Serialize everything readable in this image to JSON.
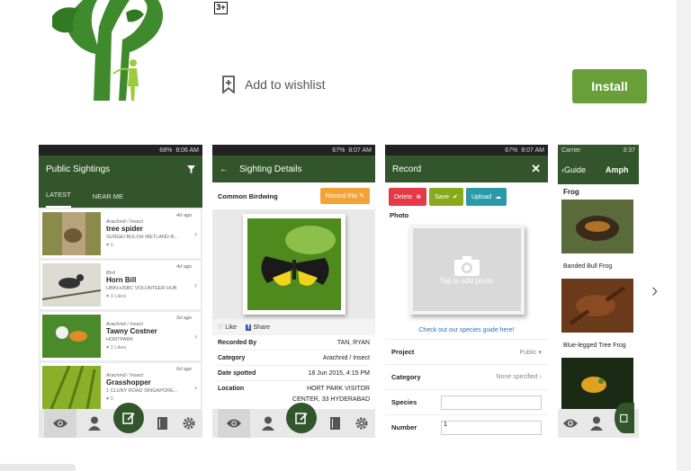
{
  "header": {
    "content_rating": "3+",
    "wishlist_label": "Add to wishlist",
    "install_label": "Install"
  },
  "screens": {
    "s1": {
      "status_time": "8:06 AM",
      "status_battery": "68%",
      "title": "Public Sightings",
      "tabs": [
        "LATEST",
        "NEAR ME"
      ],
      "items": [
        {
          "category": "Arachnid / Insect",
          "ago": "4d ago",
          "name": "tree spider",
          "location": "SUNGEI BULOH WETLAND R...",
          "likes": "0"
        },
        {
          "category": "Bird",
          "ago": "4d ago",
          "name": "Horn Bill",
          "location": "UBIN-HSBC VOLUNTEER HUB",
          "likes": "3 Likes"
        },
        {
          "category": "Arachnid / Insect",
          "ago": "5d ago",
          "name": "Tawny Costner",
          "location": "HORTPARK",
          "likes": "2 Likes"
        },
        {
          "category": "Arachnid / Insect",
          "ago": "6d ago",
          "name": "Grasshopper",
          "location": "1 CLUNY ROAD SINGAPORE...",
          "likes": "0"
        }
      ]
    },
    "s2": {
      "status_time": "8:07 AM",
      "status_battery": "67%",
      "title": "Sighting Details",
      "species_name": "Common Birdwing",
      "record_btn": "Record this",
      "like": "Like",
      "share": "Share",
      "rows": [
        {
          "label": "Recorded By",
          "value": "TAN, RYAN"
        },
        {
          "label": "Category",
          "value": "Arachnid / Insect"
        },
        {
          "label": "Date spotted",
          "value": "18 Jun 2015, 4:15 PM"
        },
        {
          "label": "Location",
          "value": "HORT PARK VISITOR"
        }
      ],
      "location_line2": "CENTER, 33 HYDERABAD"
    },
    "s3": {
      "status_time": "8:07 AM",
      "status_battery": "67%",
      "title": "Record",
      "delete_btn": "Delete",
      "save_btn": "Save",
      "upload_btn": "Upload",
      "photo_label": "Photo",
      "tap_text": "Tap to add photo",
      "guide_link": "Check out our species guide here!",
      "fields": [
        {
          "label": "Project",
          "value": "Public"
        },
        {
          "label": "Category",
          "value": "None specified"
        },
        {
          "label": "Species",
          "value": ""
        },
        {
          "label": "Number",
          "value": "1"
        }
      ]
    },
    "s4": {
      "carrier": "Carrier",
      "status_time": "3:37",
      "back_label": "Guide",
      "title_partial": "Amph",
      "section": "Frog",
      "frogs": [
        "Banded Bull Frog",
        "Blue-legged Tree Frog"
      ]
    }
  },
  "colors": {
    "app_green": "#33552b",
    "install_green": "#689f38",
    "record_orange": "#f4a235",
    "delete_red": "#e53945",
    "save_green": "#8aaa1d",
    "upload_teal": "#2a9aa8",
    "link_blue": "#2a72b6"
  }
}
